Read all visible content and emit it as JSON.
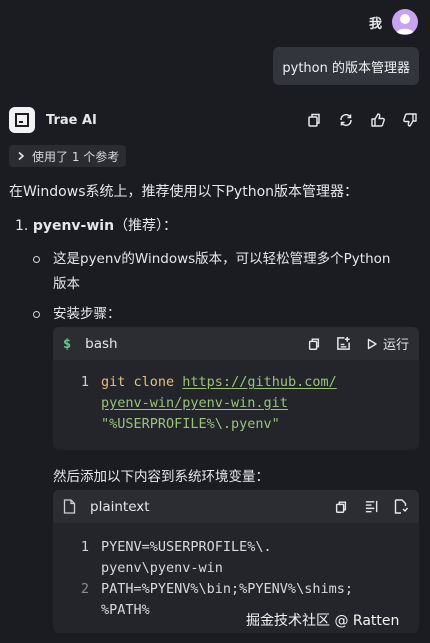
{
  "user": {
    "name": "我"
  },
  "user_message": "python 的版本管理器",
  "assistant": {
    "name": "Trae AI",
    "references": "使用了 1 个参考",
    "intro": "在Windows系统上，推荐使用以下Python版本管理器：",
    "item1_number": "1.",
    "item1_title": "pyenv-win",
    "item1_suffix": "（推荐）：",
    "bullet1_line1": "这是pyenv的Windows版本，可以轻松管理多个Python",
    "bullet1_line2": "版本",
    "bullet2": "安装步骤：",
    "code1": {
      "lang": "bash",
      "run_label": "运行",
      "line_no": "1",
      "cmd": "git clone",
      "url_part1": "https://github.com/",
      "url_part2": "pyenv-win/pyenv-win.git",
      "arg": "\"%USERPROFILE%\\.pyenv\""
    },
    "then_text": "然后添加以下内容到系统环境变量：",
    "code2": {
      "lang": "plaintext",
      "line1_no": "1",
      "line1_a": "PYENV=%USERPROFILE%\\.",
      "line1_b": "pyenv\\pyenv-win",
      "line2_no": "2",
      "line2_a": "PATH=%PYENV%\\bin;%PYENV%\\shims;",
      "line2_b": "%PATH%"
    }
  },
  "watermark": "掘金技术社区 @ Ratten",
  "colors": {
    "background": "#1b1c21",
    "bubble": "#33353d",
    "code_keyword": "#e5c07b",
    "code_string": "#98c379",
    "avatar": "#c7a3f0"
  }
}
